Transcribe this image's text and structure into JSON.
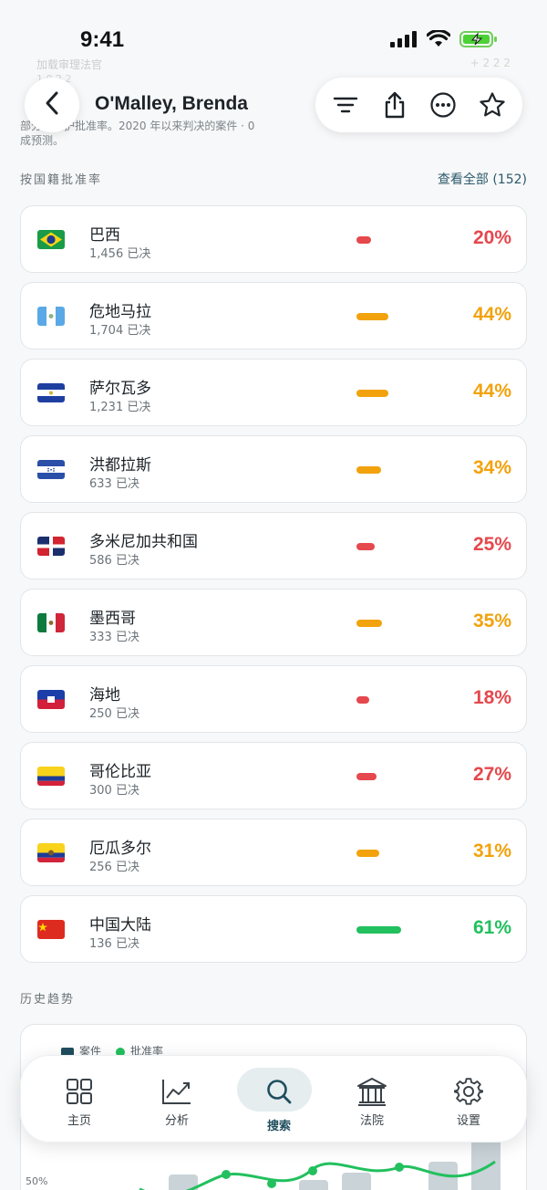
{
  "status": {
    "time": "9:41"
  },
  "header": {
    "title": "O'Malley, Brenda"
  },
  "background": {
    "line1": "加载审理法官",
    "line2": "1 0 2 2",
    "right": "+ 2 2 2",
    "desc_bold": "按...",
    "desc_rest": "部分的庇护批准率。2020 年以来判决的案件 · 0",
    "desc_line2": "成预测。"
  },
  "section": {
    "title": "按国籍批准率",
    "view_all": "查看全部 (152)"
  },
  "rows": [
    {
      "country": "巴西",
      "decided": "1,456 已决",
      "pct": "20%",
      "value": 20,
      "color": "#e5484d",
      "flag": "brazil"
    },
    {
      "country": "危地马拉",
      "decided": "1,704 已决",
      "pct": "44%",
      "value": 44,
      "color": "#f2a20c",
      "flag": "guatemala"
    },
    {
      "country": "萨尔瓦多",
      "decided": "1,231 已决",
      "pct": "44%",
      "value": 44,
      "color": "#f2a20c",
      "flag": "elsalvador"
    },
    {
      "country": "洪都拉斯",
      "decided": "633 已决",
      "pct": "34%",
      "value": 34,
      "color": "#f2a20c",
      "flag": "honduras"
    },
    {
      "country": "多米尼加共和国",
      "decided": "586 已决",
      "pct": "25%",
      "value": 25,
      "color": "#e5484d",
      "flag": "dominican"
    },
    {
      "country": "墨西哥",
      "decided": "333 已决",
      "pct": "35%",
      "value": 35,
      "color": "#f2a20c",
      "flag": "mexico"
    },
    {
      "country": "海地",
      "decided": "250 已决",
      "pct": "18%",
      "value": 18,
      "color": "#e5484d",
      "flag": "haiti"
    },
    {
      "country": "哥伦比亚",
      "decided": "300 已决",
      "pct": "27%",
      "value": 27,
      "color": "#e5484d",
      "flag": "colombia"
    },
    {
      "country": "厄瓜多尔",
      "decided": "256 已决",
      "pct": "31%",
      "value": 31,
      "color": "#f2a20c",
      "flag": "ecuador"
    },
    {
      "country": "中国大陆",
      "decided": "136 已决",
      "pct": "61%",
      "value": 61,
      "color": "#22c05e",
      "flag": "china"
    }
  ],
  "history": {
    "title": "历史趋势",
    "legend_cases": "案件",
    "legend_rate": "批准率",
    "axis_50": "50%"
  },
  "tabs": [
    {
      "label": "主页",
      "icon": "grid-icon"
    },
    {
      "label": "分析",
      "icon": "chart-icon"
    },
    {
      "label": "搜索",
      "icon": "search-icon"
    },
    {
      "label": "法院",
      "icon": "court-icon"
    },
    {
      "label": "设置",
      "icon": "gear-icon"
    }
  ],
  "colors": {
    "accent": "#1f4e5e",
    "red": "#e5484d",
    "orange": "#f2a20c",
    "green": "#22c05e"
  }
}
